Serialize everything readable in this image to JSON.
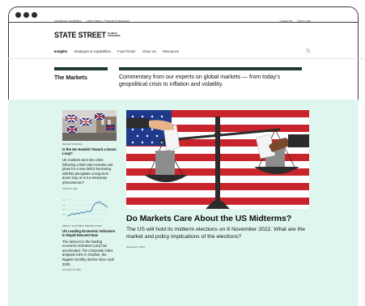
{
  "utility": {
    "left": [
      "Institutional Capabilities",
      "United States - Financial Professional"
    ],
    "right": [
      "Contact Us",
      "Client Login"
    ]
  },
  "logo": {
    "main": "STATE STREET",
    "sub": "GLOBAL ADVISORS"
  },
  "nav": {
    "items": [
      "Insights",
      "Strategies & Capabilities",
      "Fund Finder",
      "About Us",
      "Resources"
    ]
  },
  "hero": {
    "title": "The Markets",
    "description": "Commentary from our experts on global markets — from today's geopolitical crisis to inflation and volatility."
  },
  "articles": [
    {
      "tag": "MARKET UPDATES",
      "title": "Is the UK Headed Toward a Doom Loop?",
      "body": "UK markets went into crisis following a BoE rate increase and plans for a new deficit borrowing. Will this precipitate a long-term doom loop or is it a temporary phenomenon?",
      "date": "October 8, 2022"
    },
    {
      "tag": "WEEKLY ECONOMIC PERSPECTIVES",
      "title": "US Leading Economic Indicators in Rapid Descent Now",
      "body": "The descent in the leading economic indicators (LEI) has accelerated. The composite index dropped 0.8% in October, the biggest monthly decline since April 2020.",
      "date": "November 21, 2022"
    }
  ],
  "feature": {
    "title": "Do Markets Care About the US Midterms?",
    "description": "The US will hold its midterm elections on 8 November 2022. What are the market and policy implications of the elections?",
    "date": "November 3, 2022"
  },
  "colors": {
    "accent": "#1d3a2c",
    "mint": "#dff6ee",
    "flag_red": "#c8242b",
    "flag_blue": "#1f3a8a"
  },
  "icons": {
    "search": "search-icon"
  }
}
